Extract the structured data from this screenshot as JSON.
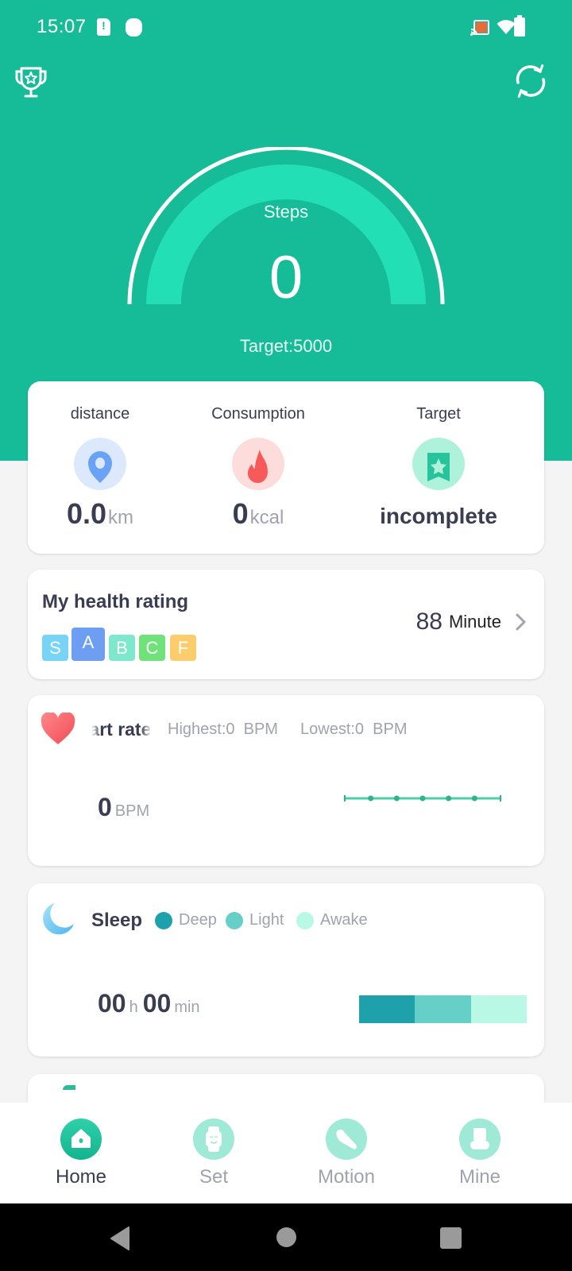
{
  "status_bar": {
    "time": "15:07",
    "left_icons": [
      "sim-alert-icon",
      "notification-dot-icon"
    ],
    "right_icons": [
      "cast-icon",
      "wifi-icon",
      "battery-icon"
    ]
  },
  "header": {
    "left_icon": "trophy-icon",
    "right_icon": "sync-icon",
    "bg_color": "#16bb98"
  },
  "steps_gauge": {
    "label": "Steps",
    "value": "0",
    "target_text": "Target:5000",
    "progress": 0
  },
  "stats": {
    "distance": {
      "label": "distance",
      "value": "0.0",
      "unit": "km",
      "icon": "location-pin-icon"
    },
    "consumption": {
      "label": "Consumption",
      "value": "0",
      "unit": "kcal",
      "icon": "flame-icon"
    },
    "target": {
      "label": "Target",
      "value": "incomplete",
      "icon": "target-star-icon"
    }
  },
  "health_rating": {
    "title": "My health rating",
    "grades": [
      {
        "label": "S",
        "color": "#77d4f7",
        "active": false
      },
      {
        "label": "A",
        "color": "#6e9ef2",
        "active": true
      },
      {
        "label": "B",
        "color": "#7ee8cc",
        "active": false
      },
      {
        "label": "C",
        "color": "#70e27a",
        "active": false
      },
      {
        "label": "F",
        "color": "#fdcc6b",
        "active": false
      }
    ],
    "value": "88",
    "unit": "Minute"
  },
  "heart_rate": {
    "title": "Heart rate",
    "visible_title": "art rate",
    "highest": "Highest:0  BPM",
    "lowest": "Lowest:0  BPM",
    "value": "0",
    "unit": "BPM",
    "chart_points": [
      0,
      0,
      0,
      0,
      0,
      0,
      0
    ]
  },
  "sleep": {
    "title": "Sleep",
    "legend": [
      {
        "label": "Deep",
        "color": "#1fa1ac"
      },
      {
        "label": "Light",
        "color": "#66d0c8"
      },
      {
        "label": "Awake",
        "color": "#b8f8e4"
      }
    ],
    "hours": "00",
    "hours_unit": "h",
    "minutes": "00",
    "minutes_unit": "min"
  },
  "tabs": [
    {
      "label": "Home",
      "icon": "home-icon",
      "active": true
    },
    {
      "label": "Set",
      "icon": "watch-icon",
      "active": false
    },
    {
      "label": "Motion",
      "icon": "shoe-icon",
      "active": false
    },
    {
      "label": "Mine",
      "icon": "person-icon",
      "active": false
    }
  ],
  "nav_bar": [
    "back",
    "home",
    "recents"
  ]
}
